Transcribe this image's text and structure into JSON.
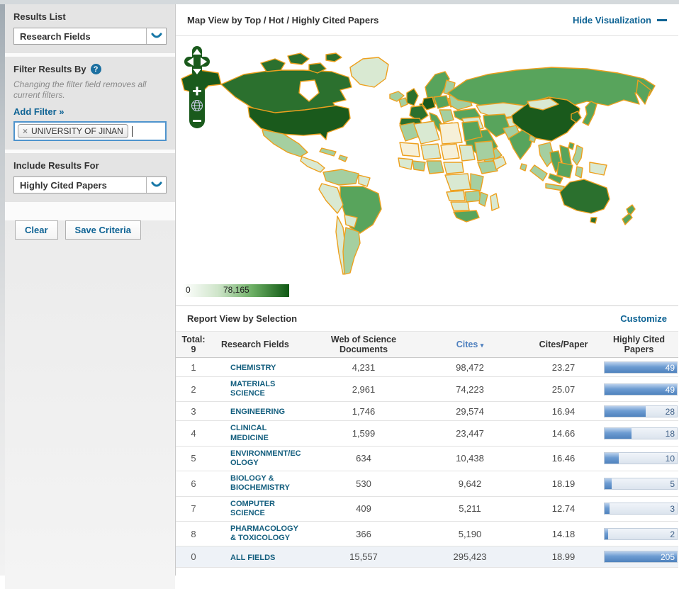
{
  "sidebar": {
    "results_list": {
      "label": "Results List",
      "selected": "Research Fields"
    },
    "filter": {
      "heading": "Filter Results By",
      "help_icon": "?",
      "hint": "Changing the filter field removes all current filters.",
      "add_filter_label": "Add Filter »",
      "tag": {
        "remove_icon": "×",
        "text": "UNIVERSITY OF JINAN"
      }
    },
    "include": {
      "label": "Include Results For",
      "selected": "Highly Cited Papers"
    },
    "buttons": {
      "clear": "Clear",
      "save": "Save Criteria"
    }
  },
  "map_panel": {
    "title": "Map View by Top / Hot / Highly Cited Papers",
    "hide_link": "Hide Visualization",
    "legend": {
      "min": "0",
      "max": "78,165"
    },
    "stroke_color": "#eda01e",
    "control_color": "#1a5a1c",
    "tiers": {
      "t1": "#1a5a1c",
      "t2": "#2b702e",
      "t3": "#58a45c",
      "t4": "#a5cfa0",
      "t5": "#d9e9d2",
      "nodata": "#f6f0d8",
      "ocean": "#ffffff"
    },
    "countries": {
      "greenland": "t5",
      "iceland": "t4",
      "alaska": "t1",
      "canada": "t2",
      "arctic1": "t2",
      "arctic2": "t2",
      "arctic3": "t2",
      "arctic4": "t2",
      "hudson": "ocean",
      "usa": "t1",
      "mexico": "t4",
      "camerica": "t5",
      "cuba": "t4",
      "hispaniola": "t4",
      "colombia": "t4",
      "guyanas": "t5",
      "brazil": "t3",
      "peru": "t5",
      "bolivia": "t5",
      "chile": "t5",
      "argentina": "t4",
      "uk": "t2",
      "ireland": "t4",
      "norway": "t3",
      "finland": "t4",
      "baltics": "t4",
      "denmark": "t2",
      "germany": "t1",
      "france": "t2",
      "spain": "t2",
      "italy": "t3",
      "poland": "t3",
      "ukraine": "t4",
      "balkans": "t4",
      "greece": "t3",
      "russia": "t3",
      "kamchatka": "t3",
      "kazakh": "t5",
      "turkey": "t3",
      "iraq": "t5",
      "iran": "t3",
      "saudi": "t3",
      "yemen": "t4",
      "afghan": "t5",
      "pakistan": "t4",
      "india": "t3",
      "bangladesh": "t4",
      "srilanka": "t4",
      "china": "t1",
      "mongolia": "t5",
      "korea": "t2",
      "japan": "t3",
      "taiwan": "t3",
      "myanmar": "t4",
      "thailand": "t3",
      "vietnam": "t3",
      "malaysia": "t3",
      "philippines": "t4",
      "sumatra": "t4",
      "borneo": "t3",
      "java": "t4",
      "sulawesi": "t4",
      "newguinea": "t5",
      "australia": "t2",
      "tasmania": "t2",
      "nz1": "t3",
      "nz2": "t3",
      "morocco": "t4",
      "algeria": "t5",
      "libya": "nodata",
      "egypt": "t3",
      "mauritania": "nodata",
      "mali": "t5",
      "niger": "nodata",
      "chad": "t5",
      "sudan": "t4",
      "senegal": "t5",
      "ghana": "t4",
      "nigeria": "t4",
      "cameroon": "t5",
      "ethiopia": "t4",
      "somalia": "t5",
      "drc": "t5",
      "kenya": "t4",
      "angola": "t5",
      "zambia": "t4",
      "mozambique": "t4",
      "namibia": "t5",
      "southafrica": "t3",
      "madagascar": "t5"
    }
  },
  "report": {
    "title": "Report View by Selection",
    "customize_link": "Customize",
    "table": {
      "total_label": "Total:",
      "total_value": "9",
      "header": {
        "research_fields": "Research Fields",
        "wos_documents": "Web of Science Documents",
        "cites": "Cites",
        "sort_arrow": "▾",
        "cites_per_paper": "Cites/Paper",
        "highly_cited_papers": "Highly Cited Papers"
      },
      "rows": [
        {
          "rank": "1",
          "field": "CHEMISTRY",
          "docs": "4,231",
          "cites": "98,472",
          "cites_per_paper": "23.27",
          "hcp": "49",
          "bar_pct": 100
        },
        {
          "rank": "2",
          "field": "MATERIALS SCIENCE",
          "docs": "2,961",
          "cites": "74,223",
          "cites_per_paper": "25.07",
          "hcp": "49",
          "bar_pct": 100
        },
        {
          "rank": "3",
          "field": "ENGINEERING",
          "docs": "1,746",
          "cites": "29,574",
          "cites_per_paper": "16.94",
          "hcp": "28",
          "bar_pct": 57
        },
        {
          "rank": "4",
          "field": "CLINICAL MEDICINE",
          "docs": "1,599",
          "cites": "23,447",
          "cites_per_paper": "14.66",
          "hcp": "18",
          "bar_pct": 37
        },
        {
          "rank": "5",
          "field": "ENVIRONMENT/ECOLOGY",
          "docs": "634",
          "cites": "10,438",
          "cites_per_paper": "16.46",
          "hcp": "10",
          "bar_pct": 20
        },
        {
          "rank": "6",
          "field": "BIOLOGY & BIOCHEMISTRY",
          "docs": "530",
          "cites": "9,642",
          "cites_per_paper": "18.19",
          "hcp": "5",
          "bar_pct": 10
        },
        {
          "rank": "7",
          "field": "COMPUTER SCIENCE",
          "docs": "409",
          "cites": "5,211",
          "cites_per_paper": "12.74",
          "hcp": "3",
          "bar_pct": 7
        },
        {
          "rank": "8",
          "field": "PHARMACOLOGY & TOXICOLOGY",
          "docs": "366",
          "cites": "5,190",
          "cites_per_paper": "14.18",
          "hcp": "2",
          "bar_pct": 5
        },
        {
          "rank": "0",
          "field": "ALL FIELDS",
          "docs": "15,557",
          "cites": "295,423",
          "cites_per_paper": "18.99",
          "hcp": "205",
          "bar_pct": 100,
          "summary": true
        }
      ]
    }
  }
}
